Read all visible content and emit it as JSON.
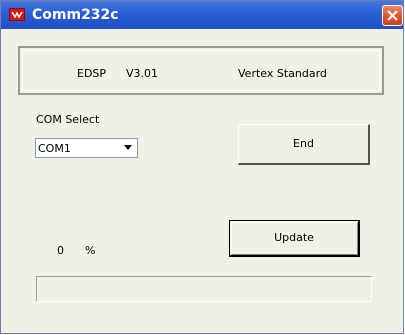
{
  "window": {
    "title": "Comm232c"
  },
  "info": {
    "product": "EDSP",
    "version": "V3.01",
    "vendor": "Vertex Standard"
  },
  "com_select": {
    "label": "COM Select",
    "value": "COM1"
  },
  "buttons": {
    "end_label": "End",
    "update_label": "Update"
  },
  "progress": {
    "value": "0",
    "unit": "%",
    "fraction": 0
  },
  "icons": {
    "app": "app-logo-icon",
    "close": "close-icon",
    "dropdown": "chevron-down-icon"
  },
  "colors": {
    "titlebar": "#2b5fd6",
    "window_bg": "#f0f0e6",
    "close": "#d9502e",
    "app_icon": "#d81818"
  }
}
